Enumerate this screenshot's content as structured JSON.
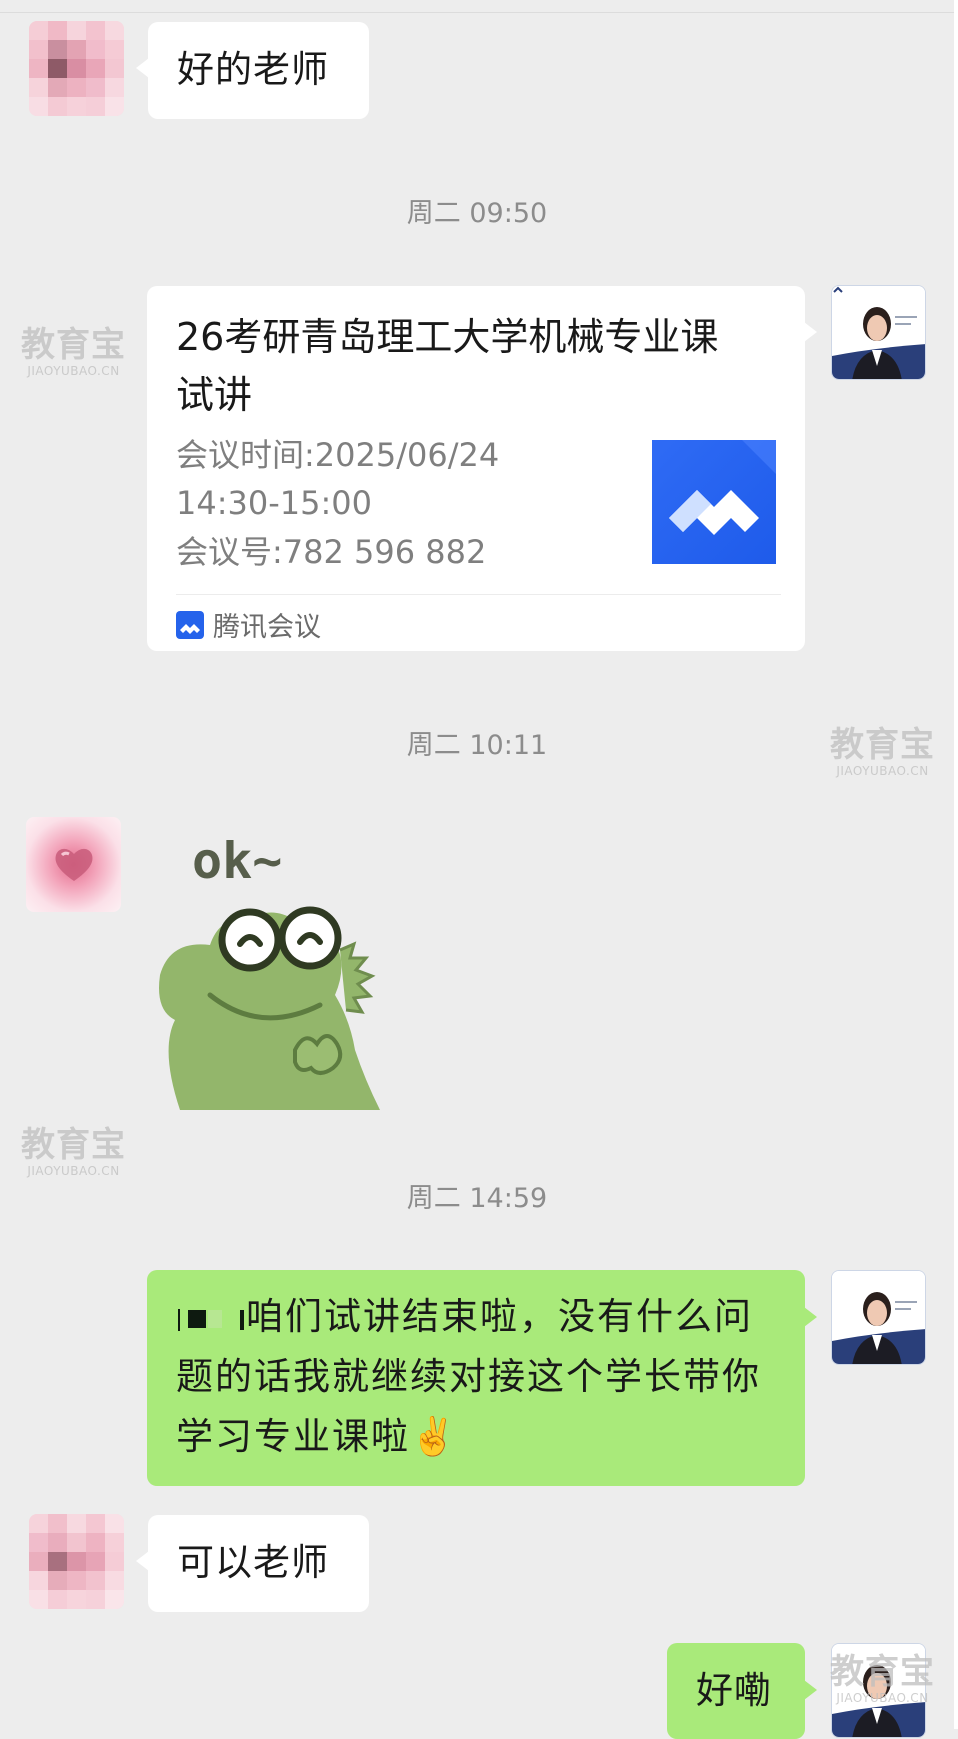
{
  "messages": [
    {
      "text": "好的老师"
    },
    {
      "time": "周二 09:50"
    },
    {
      "card": {
        "title": "26考研青岛理工大学机械专业课试讲",
        "meeting_time": "会议时间:2025/06/24 14:30-15:00",
        "meeting_time_line1": "会议时间:2025/06/24",
        "meeting_time_line2": "14:30-15:00",
        "meeting_id": "会议号:782 596 882",
        "app_name": "腾讯会议"
      }
    },
    {
      "time": "周二 10:11"
    },
    {
      "sticker": {
        "caption": "ok~"
      }
    },
    {
      "time": "周二 14:59"
    },
    {
      "text": "咱们试讲结束啦，没有什么问题的话我就继续对接这个学长带你学习专业课啦✌️"
    },
    {
      "text": "可以老师"
    },
    {
      "text": "好嘞"
    }
  ],
  "watermark": {
    "cn": "教育宝",
    "en": "JIAOYUBAO.CN"
  },
  "colors": {
    "background": "#ededed",
    "bubble_sent": "#a9ea7a",
    "bubble_received": "#ffffff",
    "meeting_blue": "#2563eb",
    "timestamp": "#8c8c8c"
  }
}
